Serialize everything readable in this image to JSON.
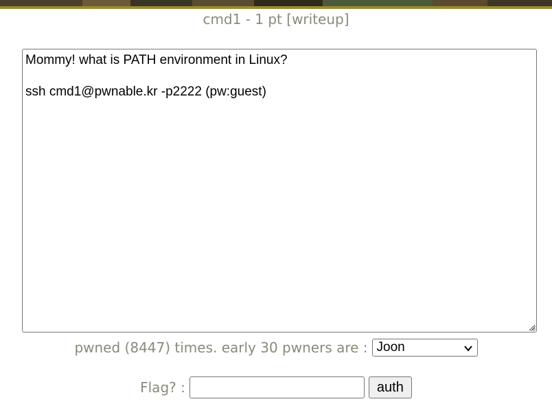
{
  "challenge": {
    "title": "cmd1 - 1 pt [writeup]",
    "description": "Mommy! what is PATH environment in Linux?\n\nssh cmd1@pwnable.kr -p2222 (pw:guest)"
  },
  "stats": {
    "pwned_text": "pwned (8447) times. early 30 pwners are :",
    "pwners_selected": "Joon"
  },
  "flag_form": {
    "label": "Flag? :",
    "input_value": "",
    "submit_label": "auth"
  },
  "colors": {
    "text_muted": "#8a8a78",
    "banner_dark": "#2e2a1e",
    "banner_gold": "#9a8a2e"
  },
  "icons": {
    "select_arrow": "chevron-down-icon",
    "textarea_grip": "resize-grip-icon"
  }
}
